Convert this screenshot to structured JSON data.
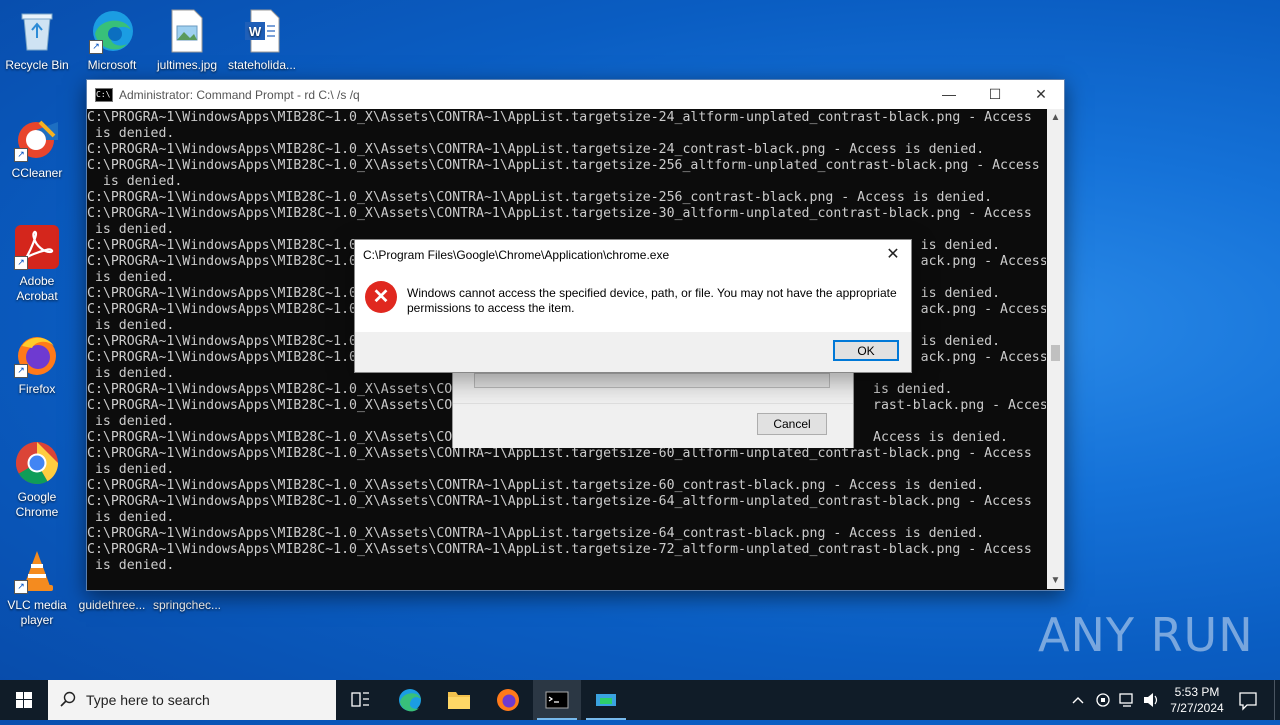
{
  "desktop": {
    "icons": [
      {
        "label": "Recycle Bin",
        "icon": "recycle-bin-icon"
      },
      {
        "label": "Microsoft Edge",
        "icon": "edge-icon"
      },
      {
        "label": "jultimes.jpg",
        "icon": "image-file-icon"
      },
      {
        "label": "stateholida...",
        "icon": "word-doc-icon"
      },
      {
        "label": "CCleaner",
        "icon": "ccleaner-icon"
      },
      {
        "label": "Adobe Acrobat",
        "icon": "acrobat-icon"
      },
      {
        "label": "Firefox",
        "icon": "firefox-icon"
      },
      {
        "label": "Google Chrome",
        "icon": "chrome-icon"
      },
      {
        "label": "VLC media player",
        "icon": "vlc-icon"
      },
      {
        "label": "guidethree...",
        "icon": "file-icon"
      },
      {
        "label": "springchec...",
        "icon": "file-icon"
      }
    ]
  },
  "cmd_window": {
    "title": "Administrator: Command Prompt - rd  C:\\ /s /q",
    "controls": {
      "minimize": "—",
      "maximize": "☐",
      "close": "✕"
    },
    "lines": [
      "C:\\PROGRA~1\\WindowsApps\\MIB28C~1.0_X\\Assets\\CONTRA~1\\AppList.targetsize-24_altform-unplated_contrast-black.png - Access",
      " is denied.",
      "C:\\PROGRA~1\\WindowsApps\\MIB28C~1.0_X\\Assets\\CONTRA~1\\AppList.targetsize-24_contrast-black.png - Access is denied.",
      "C:\\PROGRA~1\\WindowsApps\\MIB28C~1.0_X\\Assets\\CONTRA~1\\AppList.targetsize-256_altform-unplated_contrast-black.png - Access",
      "  is denied.",
      "C:\\PROGRA~1\\WindowsApps\\MIB28C~1.0_X\\Assets\\CONTRA~1\\AppList.targetsize-256_contrast-black.png - Access is denied.",
      "C:\\PROGRA~1\\WindowsApps\\MIB28C~1.0_X\\Assets\\CONTRA~1\\AppList.targetsize-30_altform-unplated_contrast-black.png - Access",
      " is denied.",
      "C:\\PROGRA~1\\WindowsApps\\MIB28C~1.0                                                                       is denied.",
      "C:\\PROGRA~1\\WindowsApps\\MIB28C~1.0                                                                       ack.png - Access",
      " is denied.",
      "C:\\PROGRA~1\\WindowsApps\\MIB28C~1.0                                                                       is denied.",
      "C:\\PROGRA~1\\WindowsApps\\MIB28C~1.0                                                                       ack.png - Access",
      " is denied.",
      "C:\\PROGRA~1\\WindowsApps\\MIB28C~1.0                                                                       is denied.",
      "C:\\PROGRA~1\\WindowsApps\\MIB28C~1.0                                                                       ack.png - Access",
      " is denied.",
      "C:\\PROGRA~1\\WindowsApps\\MIB28C~1.0_X\\Assets\\CO                                                     is denied.",
      "C:\\PROGRA~1\\WindowsApps\\MIB28C~1.0_X\\Assets\\CO                                                     rast-black.png - Access",
      " is denied.",
      "C:\\PROGRA~1\\WindowsApps\\MIB28C~1.0_X\\Assets\\CO                                                     Access is denied.",
      "C:\\PROGRA~1\\WindowsApps\\MIB28C~1.0_X\\Assets\\CONTRA~1\\AppList.targetsize-60_altform-unplated_contrast-black.png - Access",
      " is denied.",
      "C:\\PROGRA~1\\WindowsApps\\MIB28C~1.0_X\\Assets\\CONTRA~1\\AppList.targetsize-60_contrast-black.png - Access is denied.",
      "C:\\PROGRA~1\\WindowsApps\\MIB28C~1.0_X\\Assets\\CONTRA~1\\AppList.targetsize-64_altform-unplated_contrast-black.png - Access",
      " is denied.",
      "C:\\PROGRA~1\\WindowsApps\\MIB28C~1.0_X\\Assets\\CONTRA~1\\AppList.targetsize-64_contrast-black.png - Access is denied.",
      "C:\\PROGRA~1\\WindowsApps\\MIB28C~1.0_X\\Assets\\CONTRA~1\\AppList.targetsize-72_altform-unplated_contrast-black.png - Access",
      " is denied."
    ]
  },
  "progress_dialog": {
    "cancel_label": "Cancel"
  },
  "error_dialog": {
    "title": "C:\\Program Files\\Google\\Chrome\\Application\\chrome.exe",
    "message": "Windows cannot access the specified device, path, or file. You may not have the appropriate permissions to access the item.",
    "ok_label": "OK"
  },
  "watermark": {
    "text": "ANY RUN"
  },
  "taskbar": {
    "search_placeholder": "Type here to search",
    "clock": {
      "time": "5:53 PM",
      "date": "7/27/2024"
    }
  }
}
